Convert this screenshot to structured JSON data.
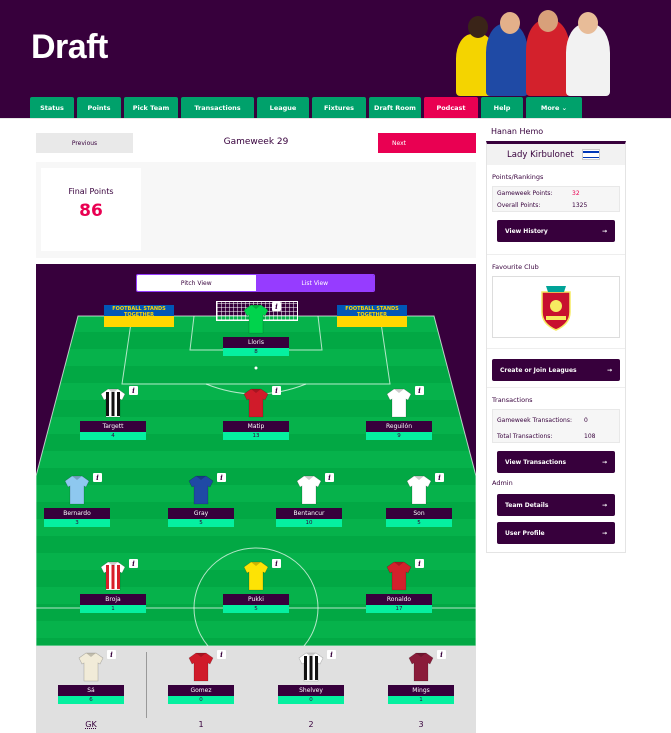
{
  "header": {
    "brand": "Draft"
  },
  "nav": [
    {
      "label": "Status",
      "w": 44
    },
    {
      "label": "Points",
      "w": 44
    },
    {
      "label": "Pick Team",
      "w": 54
    },
    {
      "label": "Transactions",
      "w": 73
    },
    {
      "label": "League",
      "w": 52
    },
    {
      "label": "Fixtures",
      "w": 54
    },
    {
      "label": "Draft Room",
      "w": 52
    },
    {
      "label": "Podcast",
      "w": 54,
      "active": true
    },
    {
      "label": "Help",
      "w": 42
    },
    {
      "label": "More ⌄",
      "w": 56
    }
  ],
  "gameweek": {
    "prev_label": "Previous",
    "title": "Gameweek 29",
    "next_label": "Next"
  },
  "points": {
    "label": "Final Points",
    "value": "86"
  },
  "view_toggle": {
    "pitch": "Pitch View",
    "list": "List View"
  },
  "banner_text": "FOOTBALL STANDS TOGETHER",
  "players": [
    {
      "name": "Lloris",
      "pts": "8",
      "shirt": "#00d34c",
      "stripe": ""
    },
    {
      "name": "Targett",
      "pts": "4",
      "shirt": "#ffffff",
      "stripe": "#111111"
    },
    {
      "name": "Matip",
      "pts": "13",
      "shirt": "#d01b2a",
      "stripe": ""
    },
    {
      "name": "Reguilón",
      "pts": "9",
      "shirt": "#ffffff",
      "stripe": ""
    },
    {
      "name": "Bernardo",
      "pts": "3",
      "shirt": "#8ec8ef",
      "stripe": ""
    },
    {
      "name": "Gray",
      "pts": "5",
      "shirt": "#1f4aa5",
      "stripe": ""
    },
    {
      "name": "Bentancur",
      "pts": "10",
      "shirt": "#ffffff",
      "stripe": ""
    },
    {
      "name": "Son",
      "pts": "5",
      "shirt": "#ffffff",
      "stripe": ""
    },
    {
      "name": "Broja",
      "pts": "1",
      "shirt": "#ffffff",
      "stripe": "#d81f2a"
    },
    {
      "name": "Pukki",
      "pts": "5",
      "shirt": "#fde305",
      "stripe": ""
    },
    {
      "name": "Ronaldo",
      "pts": "17",
      "shirt": "#d3212c",
      "stripe": ""
    }
  ],
  "bench": [
    {
      "name": "Sá",
      "pts": "6",
      "shirt": "#f1ebd8",
      "stripe": "",
      "label": "GK"
    },
    {
      "name": "Gomez",
      "pts": "0",
      "shirt": "#d01b2a",
      "stripe": "",
      "label": "1"
    },
    {
      "name": "Shelvey",
      "pts": "0",
      "shirt": "#ffffff",
      "stripe": "#111111",
      "label": "2"
    },
    {
      "name": "Mings",
      "pts": "1",
      "shirt": "#8a1c3a",
      "stripe": "",
      "label": "3"
    }
  ],
  "sidebar": {
    "manager": "Hanan Hemo",
    "team": "Lady Kirbulonet",
    "points_title": "Points/Rankings",
    "gw_points_label": "Gameweek Points:",
    "gw_points": "32",
    "overall_label": "Overall Points:",
    "overall": "1325",
    "view_history": "View History",
    "fav_title": "Favourite Club",
    "create_leagues": "Create or Join Leagues",
    "trans_title": "Transactions",
    "gw_trans_label": "Gameweek Transactions:",
    "gw_trans": "0",
    "total_trans_label": "Total Transactions:",
    "total_trans": "108",
    "view_trans": "View Transactions",
    "admin_title": "Admin",
    "team_details": "Team Details",
    "user_profile": "User Profile",
    "arrow": "→"
  }
}
